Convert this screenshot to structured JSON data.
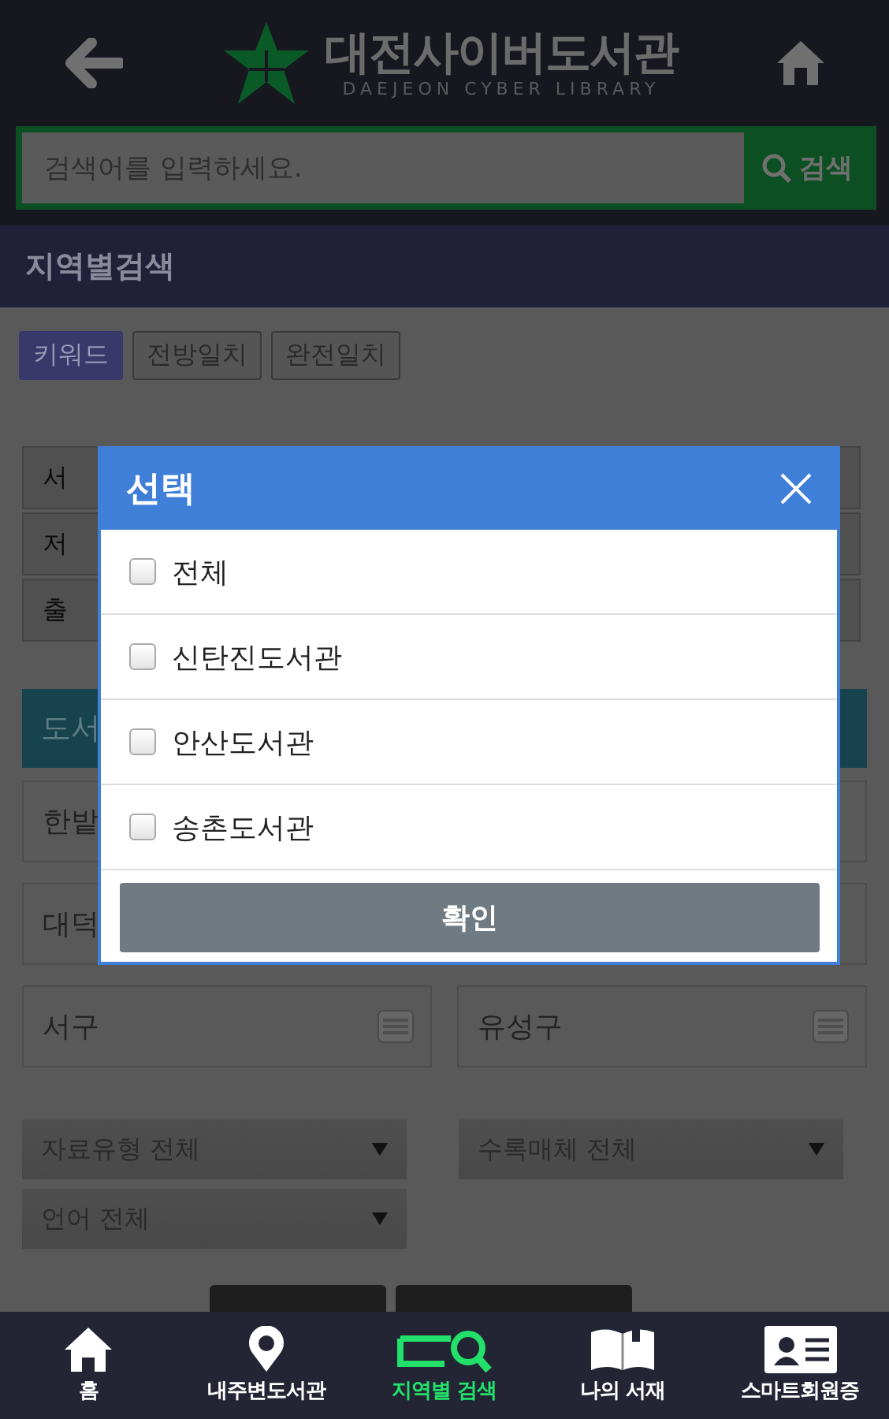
{
  "header": {
    "title": "대전사이버도서관",
    "subtitle": "DAEJEON CYBER LIBRARY"
  },
  "search": {
    "placeholder": "검색어를 입력하세요.",
    "button": "검색"
  },
  "section_title": "지역별검색",
  "match_tabs": [
    {
      "label": "키워드",
      "selected": true
    },
    {
      "label": "전방일치",
      "selected": false
    },
    {
      "label": "완전일치",
      "selected": false
    }
  ],
  "search_fields": [
    "서",
    "저",
    "출"
  ],
  "library_header": "도서",
  "region_rows": [
    {
      "left": "한밭"
    },
    {
      "left": "대덕"
    },
    {
      "left": "서구",
      "right": "유성구"
    }
  ],
  "filters": [
    {
      "label": "자료유형 전체"
    },
    {
      "label": "수록매체 전체"
    },
    {
      "label": "언어 전체"
    }
  ],
  "modal": {
    "title": "선택",
    "confirm": "확인",
    "options": [
      {
        "label": "전체",
        "checked": false
      },
      {
        "label": "신탄진도서관",
        "checked": false
      },
      {
        "label": "안산도서관",
        "checked": false
      },
      {
        "label": "송촌도서관",
        "checked": false
      }
    ]
  },
  "nav": [
    {
      "label": "홈",
      "selected": false
    },
    {
      "label": "내주변도서관",
      "selected": false
    },
    {
      "label": "지역별 검색",
      "selected": true
    },
    {
      "label": "나의 서재",
      "selected": false
    },
    {
      "label": "스마트회원증",
      "selected": false
    }
  ]
}
